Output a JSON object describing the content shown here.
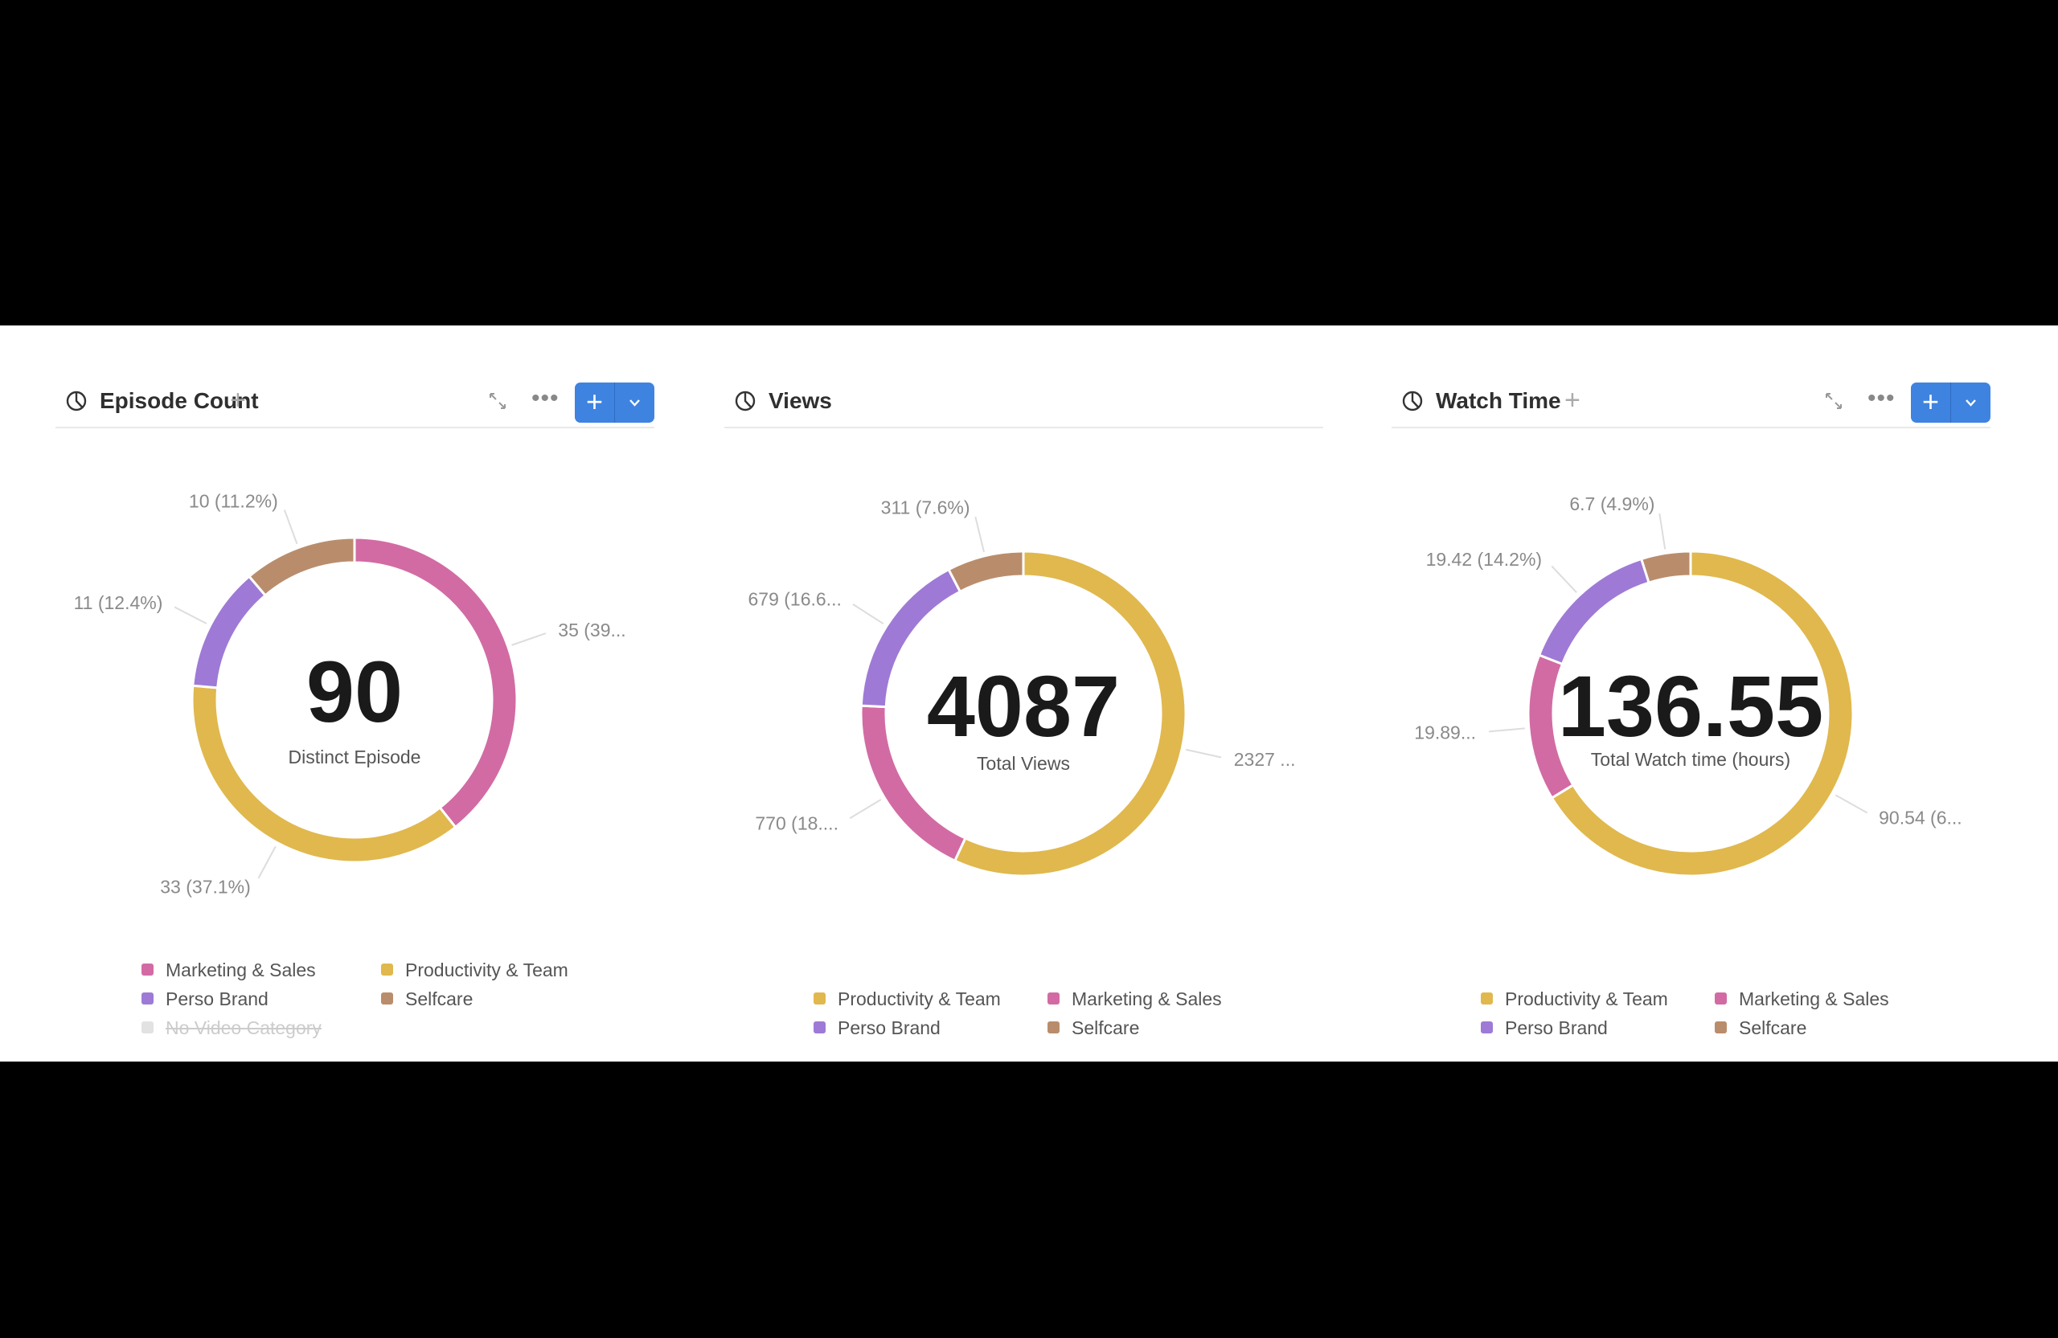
{
  "colors": {
    "Marketing & Sales": "#d26ba4",
    "Productivity & Team": "#e0b84e",
    "Perso Brand": "#9e7ad6",
    "Selfcare": "#b98d6c",
    "No Video Category": "#e2e2e2",
    "accent": "#3f83e0"
  },
  "icons": {
    "chart": "pie-chart-icon",
    "add": "plus-icon",
    "expand": "expand-icon",
    "more": "more-icon",
    "dropdown": "chevron-down-icon"
  },
  "chart_data": [
    {
      "type": "pie",
      "title": "Episode Count",
      "center_value": "90",
      "center_label": "Distinct Episode",
      "categories": [
        "Marketing & Sales",
        "Productivity & Team",
        "Perso Brand",
        "Selfcare"
      ],
      "values": [
        35,
        33,
        11,
        10
      ],
      "data_labels": [
        "35 (39...",
        "33 (37.1%)",
        "11 (12.4%)",
        "10 (11.2%)"
      ],
      "legend": [
        {
          "label": "Marketing & Sales"
        },
        {
          "label": "Productivity & Team"
        },
        {
          "label": "Perso Brand"
        },
        {
          "label": "Selfcare"
        },
        {
          "label": "No Video Category",
          "hidden": true
        }
      ]
    },
    {
      "type": "pie",
      "title": "Views",
      "center_value": "4087",
      "center_label": "Total Views",
      "categories": [
        "Productivity & Team",
        "Marketing & Sales",
        "Perso Brand",
        "Selfcare"
      ],
      "values": [
        2327,
        770,
        679,
        311
      ],
      "data_labels": [
        "2327 ...",
        "770 (18....",
        "679 (16.6...",
        "311 (7.6%)"
      ],
      "legend": [
        {
          "label": "Productivity & Team"
        },
        {
          "label": "Marketing & Sales"
        },
        {
          "label": "Perso Brand"
        },
        {
          "label": "Selfcare"
        }
      ]
    },
    {
      "type": "pie",
      "title": "Watch Time",
      "center_value": "136.55",
      "center_label": "Total Watch time (hours)",
      "categories": [
        "Productivity & Team",
        "Marketing & Sales",
        "Perso Brand",
        "Selfcare"
      ],
      "values": [
        90.54,
        19.89,
        19.42,
        6.7
      ],
      "data_labels": [
        "90.54 (6...",
        "19.89...",
        "19.42 (14.2%)",
        "6.7 (4.9%)"
      ],
      "legend": [
        {
          "label": "Productivity & Team"
        },
        {
          "label": "Marketing & Sales"
        },
        {
          "label": "Perso Brand"
        },
        {
          "label": "Selfcare"
        }
      ]
    }
  ]
}
